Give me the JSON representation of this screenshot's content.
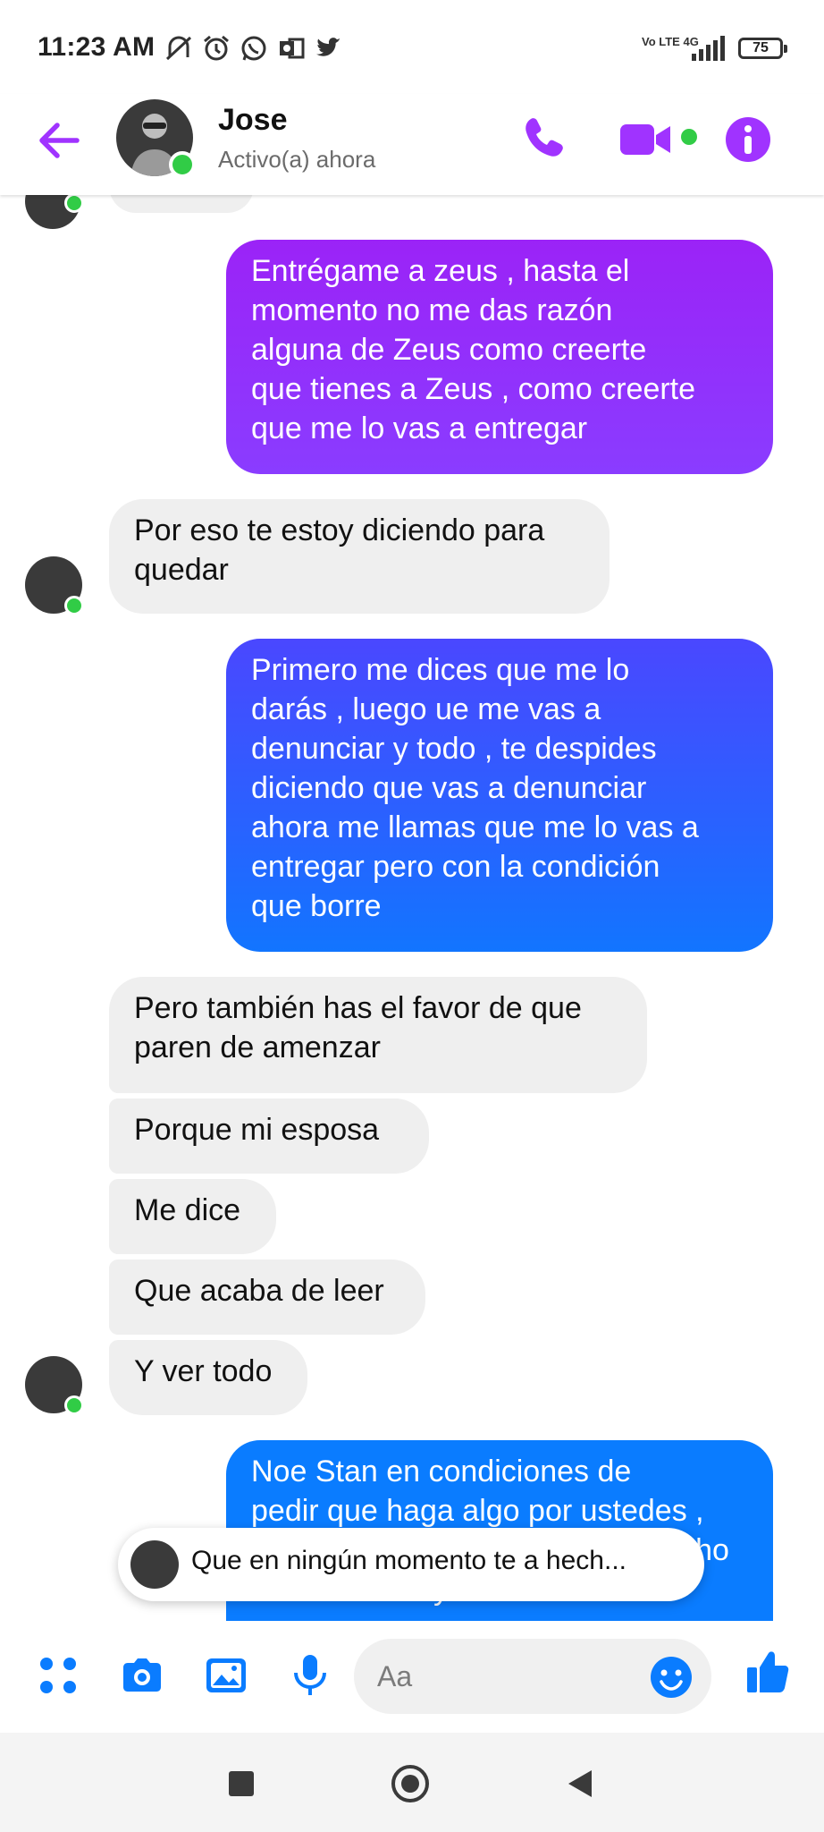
{
  "status_bar": {
    "time": "11:23 AM",
    "icons": [
      "muted-vibrate-icon",
      "alarm-icon",
      "whatsapp-icon",
      "outlook-icon",
      "twitter-icon"
    ],
    "network": "Vo LTE 4G",
    "battery": "75"
  },
  "header": {
    "back_icon": "arrow-left-icon",
    "contact_name": "Jose",
    "contact_status": "Activo(a) ahora",
    "actions": [
      "phone-icon",
      "video-camera-icon",
      "info-icon"
    ]
  },
  "colors": {
    "accent_purple": "#a033ff",
    "messenger_blue": "#0a7cff",
    "online_green": "#31cc46",
    "incoming_bubble": "#efefef",
    "composer_blue": "#0a7cff"
  },
  "messages": [
    {
      "side": "out",
      "text": "Entrégame a zeus , hasta el\nmomento no me das razón\nalguna de Zeus como creerte\nque tienes a Zeus , como creerte\nque me lo vas a entregar"
    },
    {
      "side": "in",
      "text": "Por eso te estoy diciendo para\nquedar"
    },
    {
      "side": "out",
      "text": "Primero me dices que me lo\ndarás , luego ue me vas a\ndenunciar y todo , te despides\ndiciendo que vas a denunciar\nahora me llamas que me lo vas a\nentregar pero con la condición\nque borre"
    },
    {
      "side": "in",
      "text": "Pero también has el favor de que\nparen de amenzar"
    },
    {
      "side": "in",
      "text": "Porque mi esposa"
    },
    {
      "side": "in",
      "text": "Me dice"
    },
    {
      "side": "in",
      "text": "Que acaba de leer"
    },
    {
      "side": "in",
      "text": "Y ver todo"
    },
    {
      "side": "out",
      "text": "Noe Stan en condiciones de\npedir que haga algo por ustedes ,\nque en ningún momento te a hecho\nhace un mes y ahora me"
    }
  ],
  "preview_toast": {
    "text": "Que en ningún momento te a hech..."
  },
  "composer": {
    "icons": [
      "apps-icon",
      "camera-icon",
      "gallery-icon",
      "microphone-icon"
    ],
    "placeholder": "Aa",
    "emoji_icon": "emoji-icon",
    "send_icon": "thumbs-up-icon"
  },
  "nav_bar": {
    "icons": [
      "recents-square-icon",
      "home-circle-icon",
      "back-triangle-icon"
    ]
  }
}
